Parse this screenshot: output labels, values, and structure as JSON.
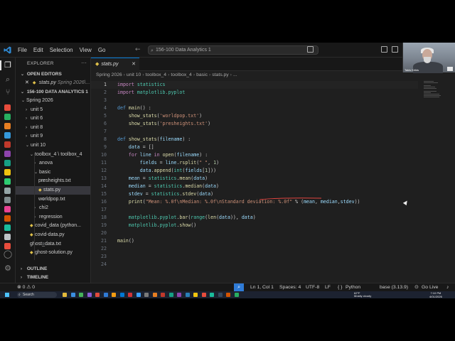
{
  "window": {
    "title": "156-100 Data Analytics 1",
    "menu": [
      "File",
      "Edit",
      "Selection",
      "View",
      "Go"
    ],
    "nav_arrows": "← →"
  },
  "webcam": {
    "name": "Takis Krikis"
  },
  "activitybar": {
    "icons": [
      "files-icon",
      "search-icon",
      "source-control-icon",
      "run-debug-icon",
      "extensions-icon"
    ],
    "extension_colors": [
      "#e74c3c",
      "#27ae60",
      "#e67e22",
      "#3498db",
      "#c0392b",
      "#8e44ad",
      "#16a085",
      "#f1c40f",
      "#2ecc71",
      "#95a5a6",
      "#7f8c8d",
      "#e84393",
      "#d35400",
      "#1abc9c",
      "#bdc3c7",
      "#e74c3c"
    ],
    "bottom": [
      "account-icon",
      "settings-icon"
    ]
  },
  "sidebar": {
    "header": "EXPLORER",
    "open_editors_label": "OPEN EDITORS",
    "open_editor": {
      "name": "stats.py",
      "path": "Spring 2026\\..."
    },
    "workspace_label": "156-100 DATA ANALYTICS 1",
    "tree": [
      {
        "label": "Spring 2026",
        "type": "folder",
        "open": true,
        "indent": 1
      },
      {
        "label": "unit 5",
        "type": "folder",
        "open": false,
        "indent": 2
      },
      {
        "label": "unit 6",
        "type": "folder",
        "open": false,
        "indent": 2
      },
      {
        "label": "unit 8",
        "type": "folder",
        "open": false,
        "indent": 2
      },
      {
        "label": "unit 9",
        "type": "folder",
        "open": false,
        "indent": 2
      },
      {
        "label": "unit 10",
        "type": "folder",
        "open": true,
        "indent": 2
      },
      {
        "label": "toolbox_4 \\ toolbox_4",
        "type": "folder",
        "open": true,
        "indent": 3
      },
      {
        "label": "anova",
        "type": "folder",
        "open": false,
        "indent": 4
      },
      {
        "label": "basic",
        "type": "folder",
        "open": true,
        "indent": 4
      },
      {
        "label": "presheights.txt",
        "type": "txt",
        "indent": 5
      },
      {
        "label": "stats.py",
        "type": "py",
        "indent": 5,
        "selected": true
      },
      {
        "label": "worldpop.txt",
        "type": "txt",
        "indent": 5
      },
      {
        "label": "chi2",
        "type": "folder",
        "open": false,
        "indent": 4
      },
      {
        "label": "regression",
        "type": "folder",
        "open": false,
        "indent": 4
      },
      {
        "label": "covid_data (python...",
        "type": "py",
        "indent": 3
      },
      {
        "label": "covid-data.py",
        "type": "py",
        "indent": 3
      },
      {
        "label": "ghost_data.txt",
        "type": "txt",
        "indent": 3
      },
      {
        "label": "ghost-solution.py",
        "type": "py",
        "indent": 3
      }
    ],
    "outline_label": "OUTLINE",
    "timeline_label": "TIMELINE"
  },
  "editor": {
    "tab": {
      "name": "stats.py"
    },
    "breadcrumb": [
      "Spring 2026",
      "unit 10",
      "toolbox_4",
      "toolbox_4",
      "basic",
      "stats.py",
      "..."
    ],
    "current_line": 1,
    "lines": [
      [
        [
          "kw",
          "import"
        ],
        [
          "t",
          " "
        ],
        [
          "md",
          "statistics"
        ]
      ],
      [
        [
          "kw",
          "import"
        ],
        [
          "t",
          " "
        ],
        [
          "md",
          "matplotlib.pyplot"
        ]
      ],
      [],
      [
        [
          "df",
          "def"
        ],
        [
          "t",
          " "
        ],
        [
          "fn",
          "main"
        ],
        [
          "t",
          "() :"
        ]
      ],
      [
        [
          "t",
          "    "
        ],
        [
          "fn",
          "show_stats"
        ],
        [
          "t",
          "("
        ],
        [
          "st",
          "'worldpop.txt'"
        ],
        [
          "t",
          ")"
        ]
      ],
      [
        [
          "t",
          "    "
        ],
        [
          "fn",
          "show_stats"
        ],
        [
          "t",
          "("
        ],
        [
          "st",
          "'presheights.txt'"
        ],
        [
          "t",
          ")"
        ]
      ],
      [],
      [
        [
          "df",
          "def"
        ],
        [
          "t",
          " "
        ],
        [
          "fn",
          "show_stats"
        ],
        [
          "t",
          "("
        ],
        [
          "vr",
          "filename"
        ],
        [
          "t",
          ") :"
        ]
      ],
      [
        [
          "t",
          "    "
        ],
        [
          "vr",
          "data"
        ],
        [
          "t",
          " = []"
        ]
      ],
      [
        [
          "t",
          "    "
        ],
        [
          "kw",
          "for"
        ],
        [
          "t",
          " "
        ],
        [
          "vr",
          "line"
        ],
        [
          "t",
          " "
        ],
        [
          "kw",
          "in"
        ],
        [
          "t",
          " "
        ],
        [
          "fn",
          "open"
        ],
        [
          "t",
          "("
        ],
        [
          "vr",
          "filename"
        ],
        [
          "t",
          ") :"
        ]
      ],
      [
        [
          "t",
          "        "
        ],
        [
          "vr",
          "fields"
        ],
        [
          "t",
          " = "
        ],
        [
          "vr",
          "line"
        ],
        [
          "t",
          "."
        ],
        [
          "fn",
          "rsplit"
        ],
        [
          "t",
          "("
        ],
        [
          "st",
          "\" \""
        ],
        [
          "t",
          ", "
        ],
        [
          "nm",
          "1"
        ],
        [
          "t",
          ")"
        ]
      ],
      [
        [
          "t",
          "        "
        ],
        [
          "vr",
          "data"
        ],
        [
          "t",
          "."
        ],
        [
          "fn",
          "append"
        ],
        [
          "t",
          "("
        ],
        [
          "md",
          "int"
        ],
        [
          "t",
          "("
        ],
        [
          "vr",
          "fields"
        ],
        [
          "t",
          "["
        ],
        [
          "nm",
          "1"
        ],
        [
          "t",
          "]))"
        ]
      ],
      [
        [
          "t",
          "    "
        ],
        [
          "vr",
          "mean"
        ],
        [
          "t",
          " = "
        ],
        [
          "md",
          "statistics"
        ],
        [
          "t",
          "."
        ],
        [
          "fn",
          "mean"
        ],
        [
          "t",
          "("
        ],
        [
          "vr",
          "data"
        ],
        [
          "t",
          ")"
        ]
      ],
      [
        [
          "t",
          "    "
        ],
        [
          "vr",
          "median"
        ],
        [
          "t",
          " = "
        ],
        [
          "md",
          "statistics"
        ],
        [
          "t",
          "."
        ],
        [
          "fn",
          "median"
        ],
        [
          "t",
          "("
        ],
        [
          "vr",
          "data"
        ],
        [
          "t",
          ")"
        ]
      ],
      [
        [
          "t",
          "    "
        ],
        [
          "vr",
          "stdev"
        ],
        [
          "t",
          " = "
        ],
        [
          "md",
          "statistics"
        ],
        [
          "t",
          "."
        ],
        [
          "fn",
          "stdev"
        ],
        [
          "t",
          "("
        ],
        [
          "vr",
          "data"
        ],
        [
          "t",
          ")"
        ]
      ],
      [
        [
          "t",
          "    "
        ],
        [
          "fn",
          "print"
        ],
        [
          "t",
          "("
        ],
        [
          "st",
          "\"Mean: %.0f\\nMedian: %.0f\\nStandard deviation: %.0f\""
        ],
        [
          "t",
          " % ("
        ],
        [
          "vr",
          "mean"
        ],
        [
          "t",
          ", "
        ],
        [
          "vr",
          "median"
        ],
        [
          "t",
          ","
        ],
        [
          "vr",
          "stdev"
        ],
        [
          "t",
          "))"
        ]
      ],
      [],
      [
        [
          "t",
          "    "
        ],
        [
          "md",
          "matplotlib"
        ],
        [
          "t",
          "."
        ],
        [
          "md",
          "pyplot"
        ],
        [
          "t",
          "."
        ],
        [
          "fn",
          "bar"
        ],
        [
          "t",
          "("
        ],
        [
          "md",
          "range"
        ],
        [
          "t",
          "("
        ],
        [
          "fn",
          "len"
        ],
        [
          "t",
          "("
        ],
        [
          "vr",
          "data"
        ],
        [
          "t",
          ")), "
        ],
        [
          "vr",
          "data"
        ],
        [
          "t",
          ")"
        ]
      ],
      [
        [
          "t",
          "    "
        ],
        [
          "md",
          "matplotlib"
        ],
        [
          "t",
          "."
        ],
        [
          "md",
          "pyplot"
        ],
        [
          "t",
          "."
        ],
        [
          "fn",
          "show"
        ],
        [
          "t",
          "()"
        ]
      ],
      [],
      [
        [
          "fn",
          "main"
        ],
        [
          "t",
          "()"
        ]
      ],
      [],
      [],
      []
    ]
  },
  "statusbar": {
    "left": "⊗ 0 ⚠ 0",
    "position": "Ln 1, Col 1",
    "spaces": "Spaces: 4",
    "encoding": "UTF-8",
    "eol": "LF",
    "language": "Python",
    "interpreter": "base (3.13.9)",
    "go_live": "Go Live"
  },
  "taskbar": {
    "search": "Search",
    "app_colors": [
      "#e2b93b",
      "#3b8fe2",
      "#46b35a",
      "#8a5cd6",
      "#e24a3b",
      "#2f7bd6",
      "#f39c12",
      "#0078d4",
      "#d13438",
      "#3aa0ff",
      "#7a7a7a",
      "#e67e22",
      "#c0392b",
      "#16a085",
      "#8e44ad",
      "#2980b9",
      "#f1c40f",
      "#e74c3c",
      "#1abc9c",
      "#34495e",
      "#d35400",
      "#27ae60"
    ],
    "weather": {
      "temp": "62°F",
      "desc": "Mostly cloudy"
    },
    "time": "7:10 PM",
    "date": "4/01/2026"
  }
}
